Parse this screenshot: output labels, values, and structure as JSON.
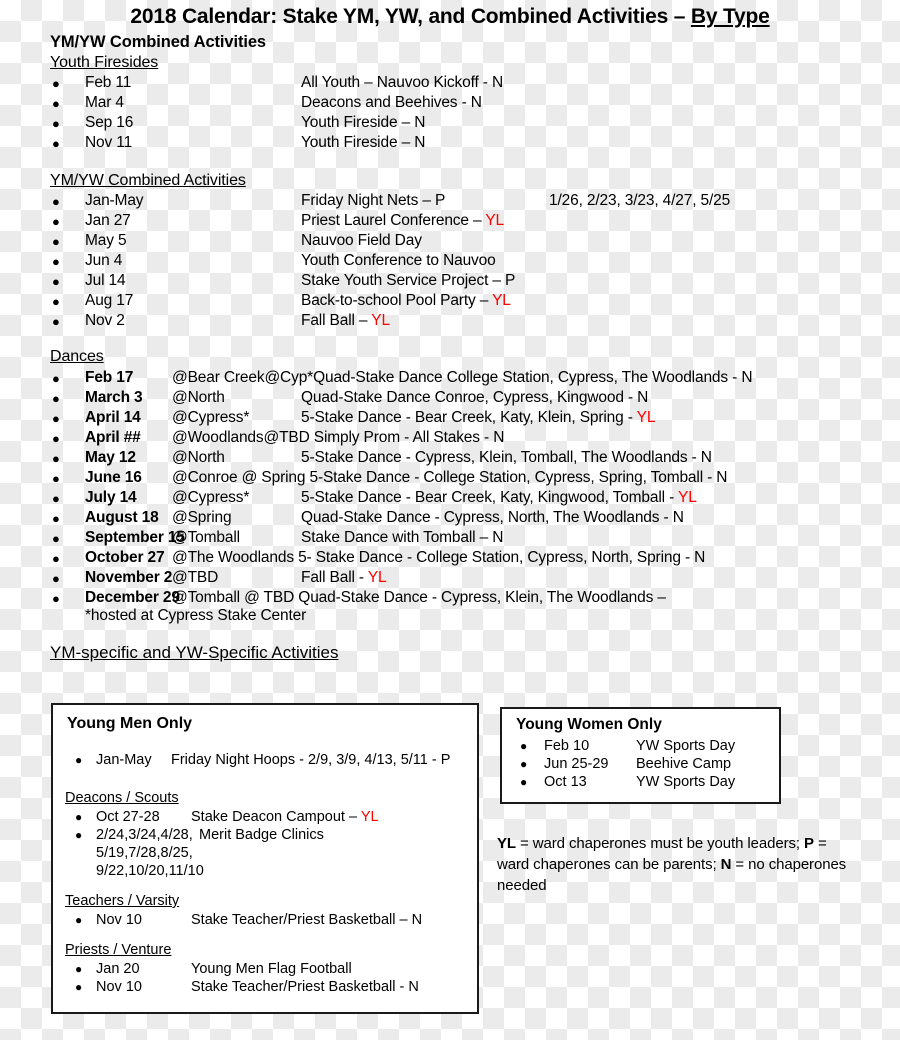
{
  "document": {
    "title_main": "2018 Calendar: Stake YM, YW, and Combined Activities – ",
    "title_underlined": "By Type"
  },
  "sections": {
    "combined_heading": "YM/YW Combined Activities",
    "youth_firesides_heading": "Youth Firesides",
    "youth_firesides": [
      {
        "date": "Feb 11",
        "desc": "All Youth – Nauvoo Kickoff - N"
      },
      {
        "date": "Mar 4",
        "desc": "Deacons and Beehives - N"
      },
      {
        "date": "Sep 16",
        "desc": "Youth Fireside – N"
      },
      {
        "date": "Nov 11",
        "desc": "Youth Fireside – N"
      }
    ],
    "combined_sub_heading": "YM/YW Combined Activities",
    "combined_activities": [
      {
        "date": "Jan-May",
        "desc": "Friday Night Nets – P",
        "tag": "",
        "extra": "1/26, 2/23, 3/23, 4/27, 5/25"
      },
      {
        "date": "Jan 27",
        "desc": "Priest Laurel Conference – ",
        "tag": "YL",
        "extra": ""
      },
      {
        "date": "May 5",
        "desc": "Nauvoo Field Day",
        "tag": "",
        "extra": ""
      },
      {
        "date": "Jun 4",
        "desc": "Youth Conference to Nauvoo",
        "tag": "",
        "extra": ""
      },
      {
        "date": "Jul 14",
        "desc": "Stake Youth Service Project – P",
        "tag": "",
        "extra": ""
      },
      {
        "date": "Aug 17",
        "desc": "Back-to-school Pool Party – ",
        "tag": "YL",
        "extra": ""
      },
      {
        "date": "Nov 2",
        "desc": "Fall Ball – ",
        "tag": "YL",
        "extra": ""
      }
    ],
    "dances_heading": "Dances",
    "dances": [
      {
        "date": "Feb 17",
        "loc": "@Bear Creek@Cyp*",
        "desc": "Quad-Stake Dance College Station, Cypress, The Woodlands - N",
        "tag": "",
        "inline": true
      },
      {
        "date": "March 3",
        "loc": "@North",
        "desc": "Quad-Stake Dance Conroe, Cypress, Kingwood - N",
        "tag": "",
        "inline": false
      },
      {
        "date": "April 14",
        "loc": "@Cypress*",
        "desc": "5-Stake Dance - Bear Creek, Katy, Klein, Spring - ",
        "tag": "YL",
        "inline": false
      },
      {
        "date": "April ##",
        "loc": "@Woodlands@TBD ",
        "desc": "Simply Prom - All Stakes - N",
        "tag": "",
        "inline": true
      },
      {
        "date": "May 12",
        "loc": "@North",
        "desc": "5-Stake Dance  - Cypress, Klein, Tomball, The Woodlands - N",
        "tag": "",
        "inline": false
      },
      {
        "date": "June 16",
        "loc": "@Conroe @ Spring ",
        "desc": "5-Stake Dance - College Station, Cypress, Spring, Tomball - N",
        "tag": "",
        "inline": true
      },
      {
        "date": "July  14",
        "loc": "@Cypress*",
        "desc": "5-Stake Dance - Bear Creek, Katy, Kingwood, Tomball - ",
        "tag": "YL",
        "inline": false
      },
      {
        "date": "August 18",
        "loc": "@Spring",
        "desc": "Quad-Stake Dance  - Cypress, North, The Woodlands - N",
        "tag": "",
        "inline": false
      },
      {
        "date": "September 15",
        "loc": "@Tomball",
        "desc": "Stake Dance with Tomball – N",
        "tag": "",
        "inline": false
      },
      {
        "date": "October 27",
        "loc": "@The Woodlands ",
        "desc": "5- Stake Dance - College Station, Cypress, North, Spring - N",
        "tag": "",
        "inline": true
      },
      {
        "date": "November 2",
        "loc": "@TBD",
        "desc": "Fall Ball - ",
        "tag": "YL",
        "inline": false
      },
      {
        "date": "December 29",
        "loc": "@Tomball @ TBD ",
        "desc": "Quad-Stake Dance - Cypress, Klein, The Woodlands – ",
        "tag": "",
        "inline": true
      }
    ],
    "dances_footnote": "*hosted at Cypress Stake Center",
    "specific_heading": "YM-specific and YW-Specific Activities"
  },
  "young_men_box": {
    "title": "Young Men Only",
    "first_item": {
      "date": "Jan-May",
      "desc": "Friday Night Hoops - 2/9, 3/9, 4/13, 5/11 - P"
    },
    "groups": [
      {
        "heading": "Deacons / Scouts",
        "items": [
          {
            "date": "Oct 27-28",
            "desc": "Stake Deacon Campout – ",
            "tag": "YL",
            "continuation": []
          },
          {
            "date": "2/24,3/24,4/28,",
            "desc": "Merit Badge Clinics",
            "tag": "",
            "continuation": [
              "5/19,7/28,8/25,",
              "9/22,10/20,11/10"
            ]
          }
        ]
      },
      {
        "heading": "Teachers / Varsity",
        "items": [
          {
            "date": "Nov 10",
            "desc": "Stake Teacher/Priest Basketball – N",
            "tag": "",
            "continuation": []
          }
        ]
      },
      {
        "heading": "Priests / Venture",
        "items": [
          {
            "date": "Jan 20",
            "desc": "Young Men Flag Football",
            "tag": "",
            "continuation": []
          },
          {
            "date": "Nov 10",
            "desc": "Stake Teacher/Priest Basketball - N",
            "tag": "",
            "continuation": []
          }
        ]
      }
    ]
  },
  "young_women_box": {
    "title": "Young Women Only",
    "items": [
      {
        "date": "Feb 10",
        "desc": "YW Sports Day"
      },
      {
        "date": "Jun 25-29",
        "desc": "Beehive Camp"
      },
      {
        "date": "Oct 13",
        "desc": "YW Sports Day"
      }
    ]
  },
  "legend": {
    "yl_code": "YL",
    "yl_text": " = ward chaperones must be youth leaders; ",
    "p_code": "P",
    "p_text": " = ward chaperones can be parents; ",
    "n_code": "N",
    "n_text": " = no chaperones needed"
  },
  "colors": {
    "accent_red": "#ff0000",
    "text": "#000000",
    "box_border": "#1a1a1a"
  }
}
